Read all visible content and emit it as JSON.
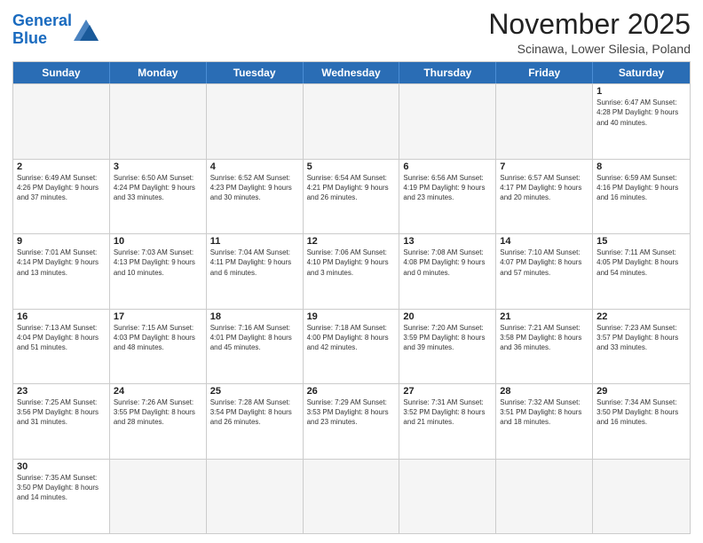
{
  "header": {
    "logo_general": "General",
    "logo_blue": "Blue",
    "month_year": "November 2025",
    "location": "Scinawa, Lower Silesia, Poland"
  },
  "calendar": {
    "days_of_week": [
      "Sunday",
      "Monday",
      "Tuesday",
      "Wednesday",
      "Thursday",
      "Friday",
      "Saturday"
    ],
    "rows": [
      [
        {
          "day": "",
          "info": ""
        },
        {
          "day": "",
          "info": ""
        },
        {
          "day": "",
          "info": ""
        },
        {
          "day": "",
          "info": ""
        },
        {
          "day": "",
          "info": ""
        },
        {
          "day": "",
          "info": ""
        },
        {
          "day": "1",
          "info": "Sunrise: 6:47 AM\nSunset: 4:28 PM\nDaylight: 9 hours and 40 minutes."
        }
      ],
      [
        {
          "day": "2",
          "info": "Sunrise: 6:49 AM\nSunset: 4:26 PM\nDaylight: 9 hours and 37 minutes."
        },
        {
          "day": "3",
          "info": "Sunrise: 6:50 AM\nSunset: 4:24 PM\nDaylight: 9 hours and 33 minutes."
        },
        {
          "day": "4",
          "info": "Sunrise: 6:52 AM\nSunset: 4:23 PM\nDaylight: 9 hours and 30 minutes."
        },
        {
          "day": "5",
          "info": "Sunrise: 6:54 AM\nSunset: 4:21 PM\nDaylight: 9 hours and 26 minutes."
        },
        {
          "day": "6",
          "info": "Sunrise: 6:56 AM\nSunset: 4:19 PM\nDaylight: 9 hours and 23 minutes."
        },
        {
          "day": "7",
          "info": "Sunrise: 6:57 AM\nSunset: 4:17 PM\nDaylight: 9 hours and 20 minutes."
        },
        {
          "day": "8",
          "info": "Sunrise: 6:59 AM\nSunset: 4:16 PM\nDaylight: 9 hours and 16 minutes."
        }
      ],
      [
        {
          "day": "9",
          "info": "Sunrise: 7:01 AM\nSunset: 4:14 PM\nDaylight: 9 hours and 13 minutes."
        },
        {
          "day": "10",
          "info": "Sunrise: 7:03 AM\nSunset: 4:13 PM\nDaylight: 9 hours and 10 minutes."
        },
        {
          "day": "11",
          "info": "Sunrise: 7:04 AM\nSunset: 4:11 PM\nDaylight: 9 hours and 6 minutes."
        },
        {
          "day": "12",
          "info": "Sunrise: 7:06 AM\nSunset: 4:10 PM\nDaylight: 9 hours and 3 minutes."
        },
        {
          "day": "13",
          "info": "Sunrise: 7:08 AM\nSunset: 4:08 PM\nDaylight: 9 hours and 0 minutes."
        },
        {
          "day": "14",
          "info": "Sunrise: 7:10 AM\nSunset: 4:07 PM\nDaylight: 8 hours and 57 minutes."
        },
        {
          "day": "15",
          "info": "Sunrise: 7:11 AM\nSunset: 4:05 PM\nDaylight: 8 hours and 54 minutes."
        }
      ],
      [
        {
          "day": "16",
          "info": "Sunrise: 7:13 AM\nSunset: 4:04 PM\nDaylight: 8 hours and 51 minutes."
        },
        {
          "day": "17",
          "info": "Sunrise: 7:15 AM\nSunset: 4:03 PM\nDaylight: 8 hours and 48 minutes."
        },
        {
          "day": "18",
          "info": "Sunrise: 7:16 AM\nSunset: 4:01 PM\nDaylight: 8 hours and 45 minutes."
        },
        {
          "day": "19",
          "info": "Sunrise: 7:18 AM\nSunset: 4:00 PM\nDaylight: 8 hours and 42 minutes."
        },
        {
          "day": "20",
          "info": "Sunrise: 7:20 AM\nSunset: 3:59 PM\nDaylight: 8 hours and 39 minutes."
        },
        {
          "day": "21",
          "info": "Sunrise: 7:21 AM\nSunset: 3:58 PM\nDaylight: 8 hours and 36 minutes."
        },
        {
          "day": "22",
          "info": "Sunrise: 7:23 AM\nSunset: 3:57 PM\nDaylight: 8 hours and 33 minutes."
        }
      ],
      [
        {
          "day": "23",
          "info": "Sunrise: 7:25 AM\nSunset: 3:56 PM\nDaylight: 8 hours and 31 minutes."
        },
        {
          "day": "24",
          "info": "Sunrise: 7:26 AM\nSunset: 3:55 PM\nDaylight: 8 hours and 28 minutes."
        },
        {
          "day": "25",
          "info": "Sunrise: 7:28 AM\nSunset: 3:54 PM\nDaylight: 8 hours and 26 minutes."
        },
        {
          "day": "26",
          "info": "Sunrise: 7:29 AM\nSunset: 3:53 PM\nDaylight: 8 hours and 23 minutes."
        },
        {
          "day": "27",
          "info": "Sunrise: 7:31 AM\nSunset: 3:52 PM\nDaylight: 8 hours and 21 minutes."
        },
        {
          "day": "28",
          "info": "Sunrise: 7:32 AM\nSunset: 3:51 PM\nDaylight: 8 hours and 18 minutes."
        },
        {
          "day": "29",
          "info": "Sunrise: 7:34 AM\nSunset: 3:50 PM\nDaylight: 8 hours and 16 minutes."
        }
      ],
      [
        {
          "day": "30",
          "info": "Sunrise: 7:35 AM\nSunset: 3:50 PM\nDaylight: 8 hours and 14 minutes."
        },
        {
          "day": "",
          "info": ""
        },
        {
          "day": "",
          "info": ""
        },
        {
          "day": "",
          "info": ""
        },
        {
          "day": "",
          "info": ""
        },
        {
          "day": "",
          "info": ""
        },
        {
          "day": "",
          "info": ""
        }
      ]
    ]
  }
}
